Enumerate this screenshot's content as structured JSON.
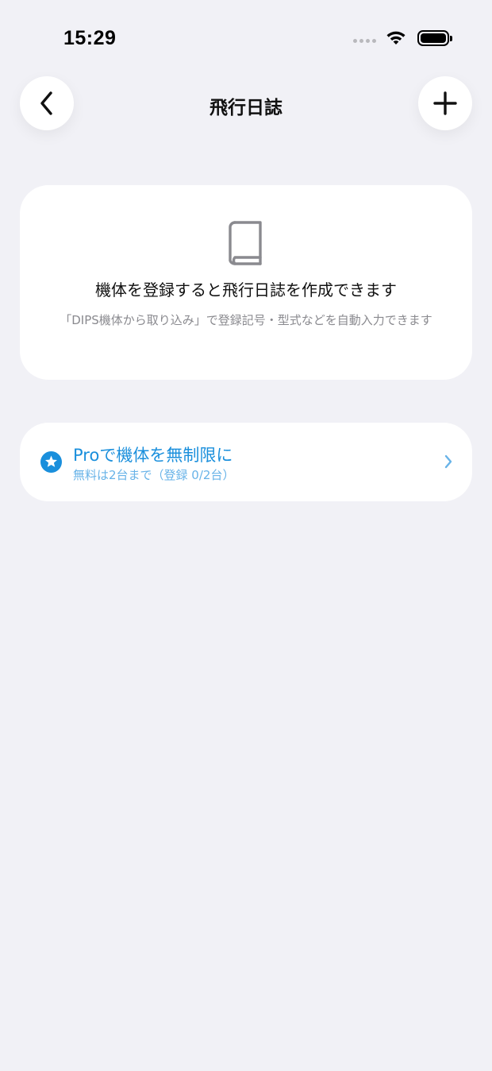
{
  "status_bar": {
    "time": "15:29"
  },
  "nav": {
    "title": "飛行日誌",
    "back_icon": "chevron-left-icon",
    "add_icon": "plus-icon"
  },
  "empty_state": {
    "icon": "book-icon",
    "title": "機体を登録すると飛行日誌を作成できます",
    "subtitle": "「DIPS機体から取り込み」で登録記号・型式などを自動入力できます"
  },
  "pro_banner": {
    "icon": "star-circle-icon",
    "title": "Proで機体を無制限に",
    "subtitle": "無料は2台まで（登録 0/2台）",
    "accent_color": "#1a8fdc"
  },
  "colors": {
    "background": "#f1f1f6",
    "card": "#ffffff",
    "accent": "#1a8fdc",
    "secondary_text": "#8a8a8f"
  }
}
